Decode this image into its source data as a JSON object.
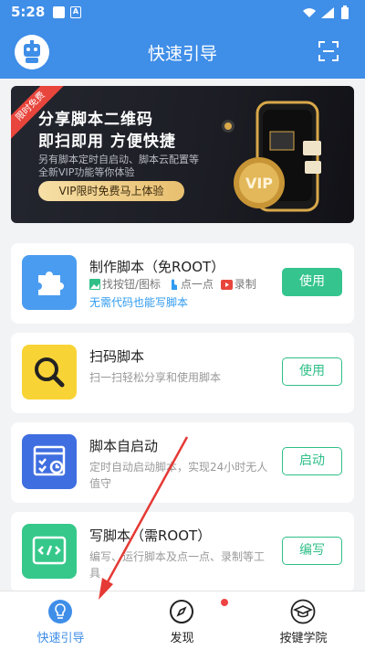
{
  "status_bar": {
    "time": "5:28",
    "notif_letter": "A"
  },
  "app_bar": {
    "title": "快速引导"
  },
  "banner": {
    "ribbon": "限时免费",
    "title_line1": "分享脚本二维码",
    "title_line2": "即扫即用 方便快捷",
    "desc_line1": "另有脚本定时自启动、脚本云配置等",
    "desc_line2": "全新VIP功能等你体验",
    "button": "VIP限时免费马上体验",
    "coin_text": "VIP"
  },
  "cards": [
    {
      "title": "制作脚本（免ROOT）",
      "features": [
        "找按钮/图标",
        "点一点",
        "录制"
      ],
      "extra": "无需代码也能写脚本",
      "button": "使用",
      "accent": "#4a9cf0"
    },
    {
      "title": "扫码脚本",
      "desc": "扫一扫轻松分享和使用脚本",
      "button": "使用",
      "accent": "#f8d335"
    },
    {
      "title": "脚本自启动",
      "desc": "定时自动启动脚本，实现24小时无人值守",
      "button": "启动",
      "accent": "#3f6ee0"
    },
    {
      "title": "写脚本（需ROOT）",
      "desc": "编写、运行脚本及点一点、录制等工具",
      "button": "编写",
      "accent": "#35c88a"
    }
  ],
  "bottom_nav": [
    {
      "label": "快速引导",
      "icon": "bulb-icon",
      "active": true
    },
    {
      "label": "发现",
      "icon": "compass-icon",
      "active": false
    },
    {
      "label": "按键学院",
      "icon": "graduation-cap-icon",
      "active": false
    }
  ],
  "colors": {
    "primary": "#3f8ee8",
    "green": "#35c48e",
    "active_nav": "#3f8ee8"
  }
}
